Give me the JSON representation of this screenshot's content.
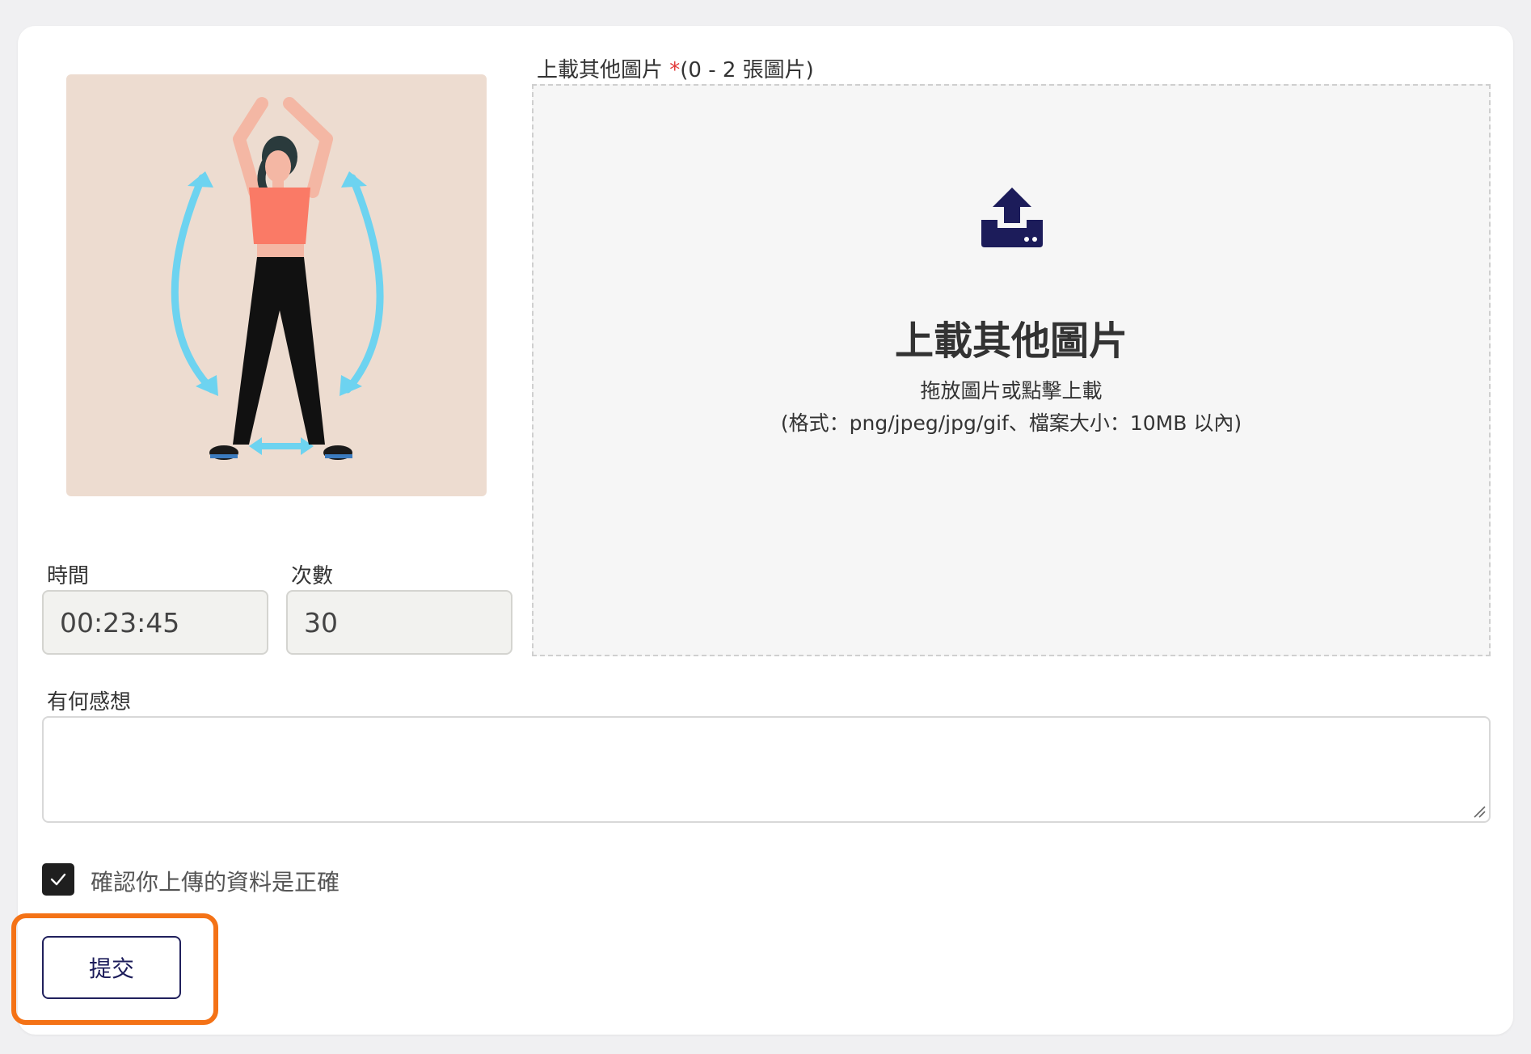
{
  "upload": {
    "label": "上載其他圖片",
    "required_mark": "*",
    "limit": "(0 - 2 張圖片)",
    "icon": "upload-tray-icon",
    "title": "上載其他圖片",
    "subtitle": "拖放圖片或點擊上載",
    "hint": "(格式：png/jpeg/jpg/gif、檔案大小：10MB 以內)"
  },
  "exercise": {
    "illustration": "jumping-jacks-illustration"
  },
  "fields": {
    "time_label": "時間",
    "time_value": "00:23:45",
    "count_label": "次數",
    "count_value": "30"
  },
  "comments": {
    "label": "有何感想",
    "value": ""
  },
  "confirm": {
    "checked": true,
    "label": "確認你上傳的資料是正確"
  },
  "submit": {
    "label": "提交"
  },
  "colors": {
    "accent": "#1c1c5a",
    "highlight": "#f47216",
    "illustration_bg": "#eddcd0",
    "arrow": "#6dd3f0"
  }
}
